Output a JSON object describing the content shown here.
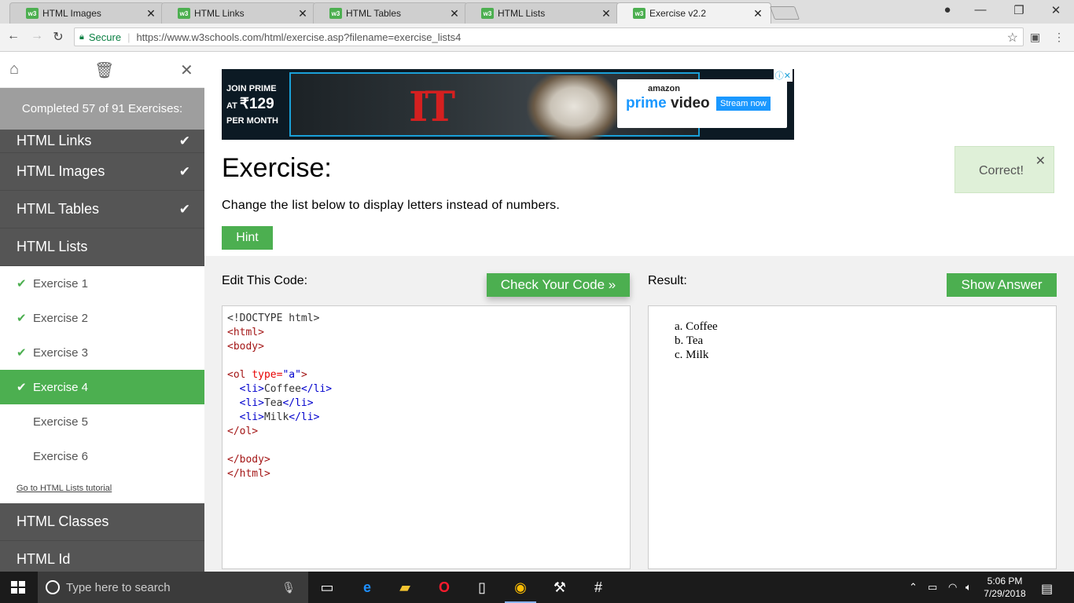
{
  "browser": {
    "tabs": [
      {
        "title": "HTML Images",
        "active": false
      },
      {
        "title": "HTML Links",
        "active": false
      },
      {
        "title": "HTML Tables",
        "active": false
      },
      {
        "title": "HTML Lists",
        "active": false
      },
      {
        "title": "Exercise v2.2",
        "active": true
      }
    ],
    "favicon_text": "w3",
    "secure_label": "Secure",
    "url": "https://www.w3schools.com/html/exercise.asp?filename=exercise_lists4"
  },
  "sidebar": {
    "progress_text": "Completed 57 of 91 Exercises:",
    "topics_before": [
      {
        "label": "HTML Links",
        "done": true
      },
      {
        "label": "HTML Images",
        "done": true
      },
      {
        "label": "HTML Tables",
        "done": true
      },
      {
        "label": "HTML Lists",
        "done": false
      }
    ],
    "exercises": [
      {
        "label": "Exercise 1",
        "done": true,
        "active": false
      },
      {
        "label": "Exercise 2",
        "done": true,
        "active": false
      },
      {
        "label": "Exercise 3",
        "done": true,
        "active": false
      },
      {
        "label": "Exercise 4",
        "done": true,
        "active": true
      },
      {
        "label": "Exercise 5",
        "done": false,
        "active": false
      },
      {
        "label": "Exercise 6",
        "done": false,
        "active": false
      }
    ],
    "tutorial_link": "Go to HTML Lists tutorial",
    "topics_after": [
      {
        "label": "HTML Classes"
      },
      {
        "label": "HTML Id"
      }
    ]
  },
  "ad": {
    "line1": "JOIN PRIME",
    "line2_prefix": "AT ",
    "line2_price": "₹129",
    "line3": "PER MONTH",
    "movie": "IT",
    "brand_top": "amazon",
    "brand_a": "prime",
    "brand_b": "video",
    "cta": "Stream now"
  },
  "exercise": {
    "title": "Exercise:",
    "description": "Change the list below to display letters instead of numbers.",
    "hint_label": "Hint",
    "correct_message": "Correct!",
    "edit_label": "Edit This Code:",
    "check_label": "Check Your Code »",
    "result_label": "Result:",
    "answer_label": "Show Answer",
    "result_items": [
      "a. Coffee",
      "b. Tea",
      "c. Milk"
    ]
  },
  "taskbar": {
    "search_placeholder": "Type here to search",
    "time": "5:06 PM",
    "date": "7/29/2018"
  }
}
